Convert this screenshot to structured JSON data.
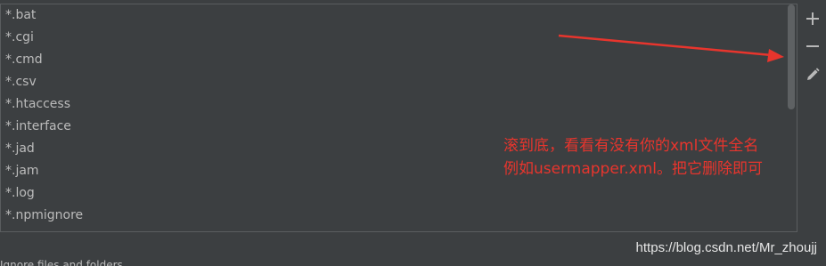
{
  "list": {
    "items": [
      "*.bat",
      "*.cgi",
      "*.cmd",
      "*.csv",
      "*.htaccess",
      "*.interface",
      "*.jad",
      "*.jam",
      "*.log",
      "*.npmignore"
    ]
  },
  "toolbar": {
    "add_icon": "plus-icon",
    "remove_icon": "minus-icon",
    "edit_icon": "pencil-icon"
  },
  "annotation": {
    "line1": "滚到底，看看有没有你的xml文件全名",
    "line2": "例如usermapper.xml。把它删除即可"
  },
  "colors": {
    "background": "#3c3f41",
    "text": "#bbbbbb",
    "annotation": "#e8352d"
  },
  "watermark": "https://blog.csdn.net/Mr_zhoujj",
  "footer": {
    "label": "Ignore files and folders"
  }
}
